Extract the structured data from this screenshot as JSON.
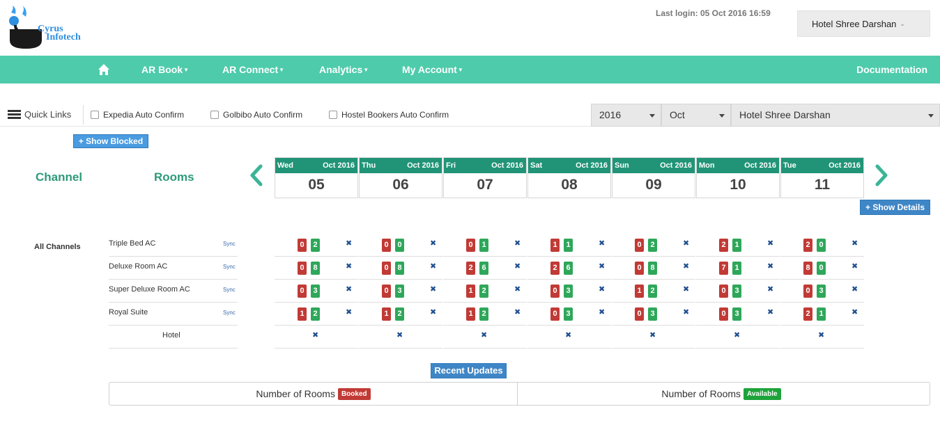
{
  "header": {
    "logo_text": [
      "Cyrus",
      "Infotech"
    ],
    "last_login": "Last login: 05 Oct 2016 16:59",
    "hotel_menu_label": "Hotel Shree Darshan"
  },
  "nav": {
    "items": [
      {
        "label": "AR Book"
      },
      {
        "label": "AR Connect"
      },
      {
        "label": "Analytics"
      },
      {
        "label": "My Account"
      }
    ],
    "documentation": "Documentation",
    "bg_color": "#4ecbab"
  },
  "quick_links": {
    "label": "Quick Links",
    "checkboxes": [
      "Expedia Auto Confirm",
      "Golbibo Auto Confirm",
      "Hostel Bookers Auto Confirm"
    ]
  },
  "filters": {
    "year": "2016",
    "month": "Oct",
    "hotel": "Hotel Shree Darshan"
  },
  "buttons": {
    "show_blocked": "+ Show Blocked",
    "show_details": "+ Show Details",
    "recent_updates": "Recent Updates"
  },
  "headers": {
    "channel": "Channel",
    "rooms": "Rooms"
  },
  "dates": [
    {
      "weekday": "Wed",
      "month": "Oct 2016",
      "day": "05"
    },
    {
      "weekday": "Thu",
      "month": "Oct 2016",
      "day": "06"
    },
    {
      "weekday": "Fri",
      "month": "Oct 2016",
      "day": "07"
    },
    {
      "weekday": "Sat",
      "month": "Oct 2016",
      "day": "08"
    },
    {
      "weekday": "Sun",
      "month": "Oct 2016",
      "day": "09"
    },
    {
      "weekday": "Mon",
      "month": "Oct 2016",
      "day": "10"
    },
    {
      "weekday": "Tue",
      "month": "Oct 2016",
      "day": "11"
    }
  ],
  "grid": {
    "channel_label": "All Channels",
    "sync_label": "Sync",
    "close_glyph": "✖",
    "rooms": [
      {
        "name": "Triple Bed AC",
        "cells": [
          [
            "0",
            "2"
          ],
          [
            "0",
            "0"
          ],
          [
            "0",
            "1"
          ],
          [
            "1",
            "1"
          ],
          [
            "0",
            "2"
          ],
          [
            "2",
            "1"
          ],
          [
            "2",
            "0"
          ]
        ]
      },
      {
        "name": "Deluxe Room AC",
        "cells": [
          [
            "0",
            "8"
          ],
          [
            "0",
            "8"
          ],
          [
            "2",
            "6"
          ],
          [
            "2",
            "6"
          ],
          [
            "0",
            "8"
          ],
          [
            "7",
            "1"
          ],
          [
            "8",
            "0"
          ]
        ]
      },
      {
        "name": "Super Deluxe Room AC",
        "cells": [
          [
            "0",
            "3"
          ],
          [
            "0",
            "3"
          ],
          [
            "1",
            "2"
          ],
          [
            "0",
            "3"
          ],
          [
            "1",
            "2"
          ],
          [
            "0",
            "3"
          ],
          [
            "0",
            "3"
          ]
        ]
      },
      {
        "name": "Royal Suite",
        "cells": [
          [
            "1",
            "2"
          ],
          [
            "1",
            "2"
          ],
          [
            "1",
            "2"
          ],
          [
            "0",
            "3"
          ],
          [
            "0",
            "3"
          ],
          [
            "0",
            "3"
          ],
          [
            "2",
            "1"
          ]
        ]
      }
    ],
    "hotel_row_label": "Hotel"
  },
  "legend": {
    "left_text": "Number of Rooms",
    "left_badge": "Booked",
    "right_text": "Number of Rooms",
    "right_badge": "Available",
    "booked_color": "#c13a35",
    "available_color": "#1ea33a"
  }
}
